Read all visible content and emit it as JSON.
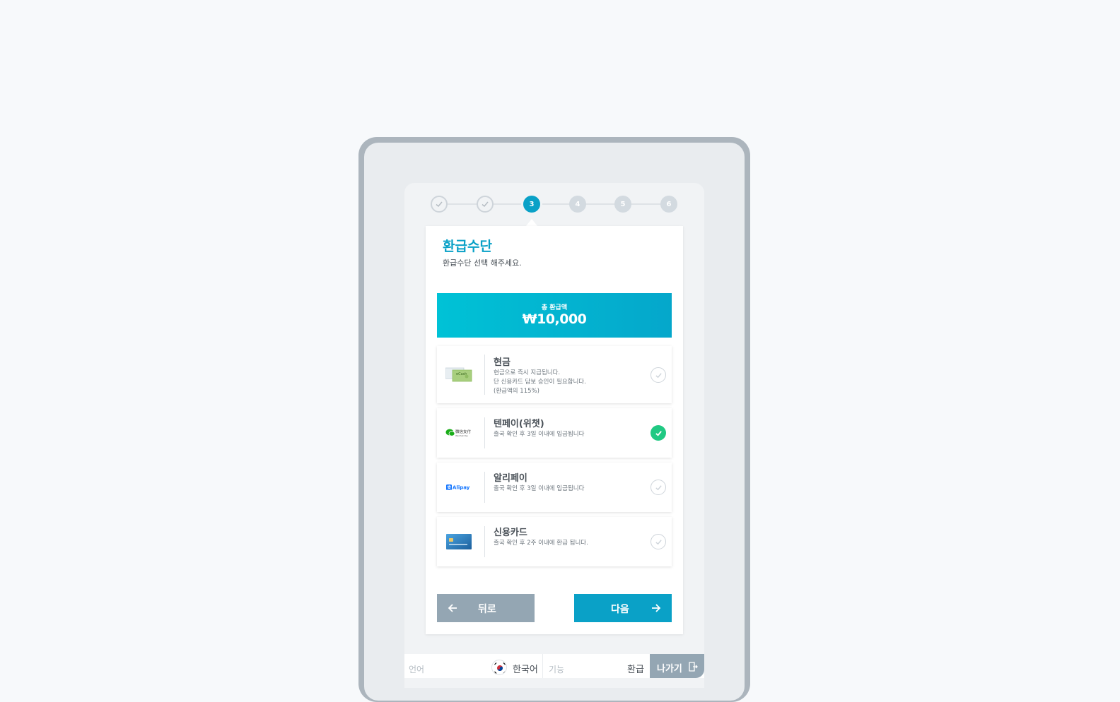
{
  "stepper": {
    "steps": [
      {
        "label": "",
        "state": "done"
      },
      {
        "label": "",
        "state": "done"
      },
      {
        "label": "3",
        "state": "active"
      },
      {
        "label": "4",
        "state": "todo"
      },
      {
        "label": "5",
        "state": "todo"
      },
      {
        "label": "6",
        "state": "todo"
      }
    ],
    "current": 3
  },
  "header": {
    "title": "환급수단",
    "subtitle": "환급수단 선택 해주세요."
  },
  "total": {
    "label": "총 환급액",
    "amount": "₩10,000"
  },
  "options": [
    {
      "name": "현금",
      "desc1": "현금으로 즉시 지급됩니다.",
      "desc2": "단 신용카드 담보 승인이 필요합니다.",
      "desc3": "(환급액의 115%)",
      "logo_text": "eCash",
      "logo_icon": "cash-icon",
      "selected": false
    },
    {
      "name": "텐페이(위챗)",
      "desc1": "출국 확인 후  3일 이내에 입금됩니다",
      "logo_text": "微信支付",
      "logo_subtext": "WeChat Pay",
      "logo_icon": "wechat-pay-icon",
      "selected": true
    },
    {
      "name": "알리페이",
      "desc1": "출국 확인 후  3일 이내에 입금됩니다",
      "logo_text": "Alipay",
      "logo_icon": "alipay-icon",
      "selected": false
    },
    {
      "name": "신용카드",
      "desc1": "출국 확인 후 2주 이내에 환급 됩니다.",
      "logo_icon": "credit-card-icon",
      "selected": false
    }
  ],
  "actions": {
    "back_label": "뒤로",
    "next_label": "다음"
  },
  "footer": {
    "language_label": "언어",
    "language_value": "한국어",
    "function_label": "기능",
    "function_value": "환급",
    "exit_label": "나가기"
  },
  "colors": {
    "accent": "#0aa1c7",
    "selected_check": "#20c983",
    "secondary_button": "#94a6b3"
  }
}
